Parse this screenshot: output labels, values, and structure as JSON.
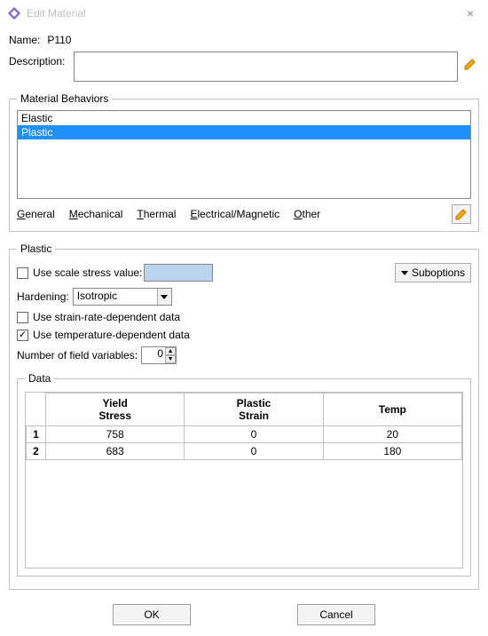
{
  "window": {
    "title": "Edit Material",
    "close_glyph": "×"
  },
  "name_label": "Name:",
  "name_value": "P110",
  "description_label": "Description:",
  "description_value": "",
  "behaviors": {
    "legend": "Material Behaviors",
    "items": [
      "Elastic",
      "Plastic"
    ],
    "selected_index": 1
  },
  "menus": {
    "general": "General",
    "mechanical": "Mechanical",
    "thermal": "Thermal",
    "electrical": "Electrical/Magnetic",
    "other": "Other"
  },
  "plastic": {
    "legend": "Plastic",
    "use_scale_label": "Use scale stress value:",
    "use_scale_checked": false,
    "scale_value": "",
    "suboptions_label": "Suboptions",
    "hardening_label": "Hardening:",
    "hardening_value": "Isotropic",
    "strain_rate_label": "Use strain-rate-dependent data",
    "strain_rate_checked": false,
    "temp_dep_label": "Use temperature-dependent data",
    "temp_dep_checked": true,
    "field_vars_label": "Number of field variables:",
    "field_vars_value": "0"
  },
  "data": {
    "legend": "Data",
    "headers": [
      "Yield Stress",
      "Plastic Strain",
      "Temp"
    ],
    "rows": [
      {
        "n": "1",
        "yield": "758",
        "strain": "0",
        "temp": "20"
      },
      {
        "n": "2",
        "yield": "683",
        "strain": "0",
        "temp": "180"
      }
    ]
  },
  "buttons": {
    "ok": "OK",
    "cancel": "Cancel"
  }
}
